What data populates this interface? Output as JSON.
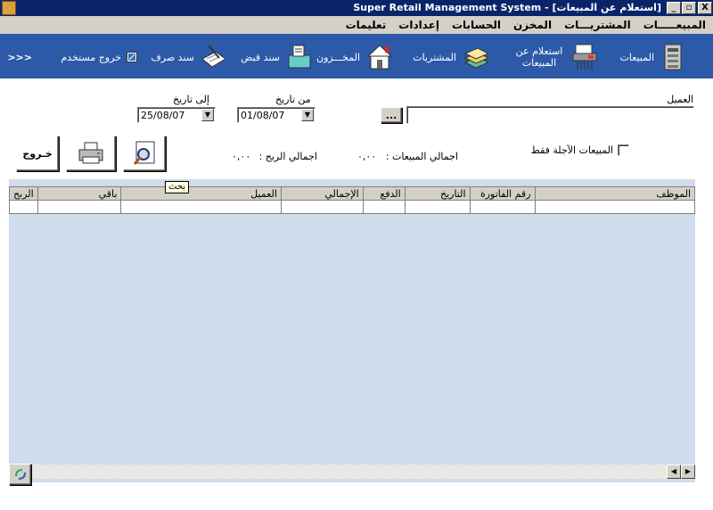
{
  "window": {
    "title": "Super Retail Management System - [استعلام عن المبيعات]",
    "buttons": {
      "minimize": "_",
      "restore": "▫",
      "close": "X"
    }
  },
  "menu": [
    "المبيعـــــات",
    "المشتريـــات",
    "المخزن",
    "الحسابات",
    "إعدادات",
    "تعليمات"
  ],
  "toolbar": {
    "sales": "المبيعات",
    "sales_inquiry": "استعلام عن المبيعات",
    "purchases": "المشتريات",
    "inventory": "المخـــزون",
    "receipt_voucher": "سند قبض",
    "payment_voucher": "سند صرف",
    "logout": "خروج مستخدم",
    "more": "<<<"
  },
  "filters": {
    "customer_label": "العميل",
    "customer_value": "",
    "browse_button": "...",
    "from_date_label": "من تاريخ",
    "from_date": "01/08/07",
    "to_date_label": "إلى تاريخ",
    "to_date": "25/08/07",
    "deferred_only": "المبيعات الآجلة فقط"
  },
  "totals": {
    "total_sales_label": "اجمالي المبيعات :",
    "total_sales_value": "٠,٠٠",
    "total_profit_label": "اجمالي الربح :",
    "total_profit_value": "٠,٠٠"
  },
  "buttons": {
    "exit": "خـروج",
    "search_tooltip": "بحث"
  },
  "grid": {
    "columns": [
      "الموظف",
      "رقم الفاتورة",
      "التاريخ",
      "الدفع",
      "الإجمالي",
      "العميل",
      "باقي",
      "الربح"
    ]
  }
}
